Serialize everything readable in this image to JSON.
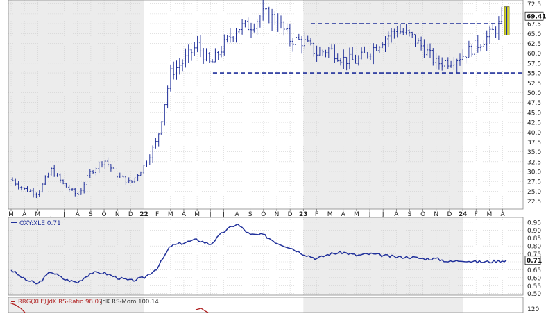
{
  "colors": {
    "price_bar": "#1f2f9a",
    "rs_line": "#1f2f9a",
    "rrg_line": "#b02020",
    "channel": "#1f2f9a",
    "highlight": "#d4d42a",
    "shade": "#ececec",
    "grid": "#cfcfcf"
  },
  "chart_data": [
    {
      "type": "ohlc",
      "panel": "price",
      "last_value_label": "69.41",
      "y_ticks": [
        "22.5",
        "25.0",
        "27.5",
        "30.0",
        "32.5",
        "35.0",
        "37.5",
        "40.0",
        "42.5",
        "45.0",
        "47.5",
        "50.0",
        "52.5",
        "55.0",
        "57.5",
        "60.0",
        "62.5",
        "65.0",
        "67.5",
        "70.0",
        "72.5"
      ],
      "x_ticks": [
        "M",
        "A",
        "M",
        "J",
        "J",
        "A",
        "S",
        "O",
        "N",
        "D",
        "22",
        "F",
        "M",
        "A",
        "M",
        "J",
        "J",
        "A",
        "S",
        "O",
        "N",
        "D",
        "23",
        "F",
        "M",
        "A",
        "M",
        "J",
        "J",
        "A",
        "S",
        "O",
        "N",
        "D",
        "24",
        "F",
        "M",
        "A"
      ],
      "ylim": [
        20.5,
        73.5
      ],
      "grid": true,
      "channel_lines": [
        {
          "label": "resistance",
          "y": 67.5
        },
        {
          "label": "support",
          "y": 55.0
        }
      ],
      "series": [
        {
          "x": [
            "Mar 2021",
            "Apr 2021",
            "May 2021",
            "Jun 2021",
            "Jul 2021",
            "Aug 2021",
            "Sep 2021",
            "Oct 2021",
            "Nov 2021",
            "Dec 2021",
            "Jan 2022",
            "Feb 2022",
            "Mar 2022",
            "Apr 2022",
            "May 2022",
            "Jun 2022",
            "Jul 2022",
            "Aug 2022",
            "Sep 2022",
            "Oct 2022",
            "Nov 2022",
            "Dec 2022",
            "Jan 2023",
            "Feb 2023",
            "Mar 2023",
            "Apr 2023",
            "May 2023",
            "Jun 2023",
            "Jul 2023",
            "Aug 2023",
            "Sep 2023",
            "Oct 2023",
            "Nov 2023",
            "Dec 2023",
            "Jan 2024",
            "Feb 2024",
            "Mar 2024",
            "Apr 2024"
          ],
          "values": [
            28.0,
            25.5,
            24.5,
            30.5,
            26.5,
            24.0,
            30.0,
            33.0,
            29.0,
            27.0,
            31.5,
            38.0,
            55.0,
            58.0,
            62.0,
            57.0,
            62.0,
            66.5,
            67.0,
            70.0,
            68.5,
            63.5,
            63.0,
            60.0,
            61.0,
            58.5,
            58.0,
            60.5,
            63.5,
            66.0,
            64.5,
            61.5,
            57.5,
            58.0,
            59.5,
            62.0,
            64.5,
            69.4
          ]
        }
      ]
    },
    {
      "type": "line",
      "panel": "relative-strength",
      "legend": "OXY:XLE 0.71",
      "last_value_label": "0.71",
      "y_ticks": [
        "0.50",
        "0.55",
        "0.60",
        "0.65",
        "0.70",
        "0.75",
        "0.80",
        "0.85",
        "0.90",
        "0.95"
      ],
      "ylim": [
        0.49,
        0.98
      ],
      "series": [
        {
          "name": "OXY:XLE",
          "x": [
            "Mar 2021",
            "Apr 2021",
            "May 2021",
            "Jun 2021",
            "Jul 2021",
            "Aug 2021",
            "Sep 2021",
            "Oct 2021",
            "Nov 2021",
            "Dec 2021",
            "Jan 2022",
            "Feb 2022",
            "Mar 2022",
            "Apr 2022",
            "May 2022",
            "Jun 2022",
            "Jul 2022",
            "Aug 2022",
            "Sep 2022",
            "Oct 2022",
            "Nov 2022",
            "Dec 2022",
            "Jan 2023",
            "Feb 2023",
            "Mar 2023",
            "Apr 2023",
            "May 2023",
            "Jun 2023",
            "Jul 2023",
            "Aug 2023",
            "Sep 2023",
            "Oct 2023",
            "Nov 2023",
            "Dec 2023",
            "Jan 2024",
            "Feb 2024",
            "Mar 2024",
            "Apr 2024"
          ],
          "values": [
            0.65,
            0.59,
            0.56,
            0.64,
            0.59,
            0.57,
            0.63,
            0.63,
            0.6,
            0.58,
            0.6,
            0.66,
            0.8,
            0.82,
            0.84,
            0.81,
            0.89,
            0.94,
            0.87,
            0.87,
            0.82,
            0.79,
            0.75,
            0.72,
            0.75,
            0.76,
            0.74,
            0.75,
            0.74,
            0.73,
            0.73,
            0.72,
            0.72,
            0.7,
            0.71,
            0.7,
            0.7,
            0.71
          ]
        }
      ]
    },
    {
      "type": "line",
      "panel": "rrg",
      "legend_label": "RRG(XLE)",
      "legend_ratio": "JdK RS-Ratio 98.07",
      "legend_mom": "JdK RS-Mom 100.14",
      "y_ticks": [
        "120"
      ]
    }
  ]
}
